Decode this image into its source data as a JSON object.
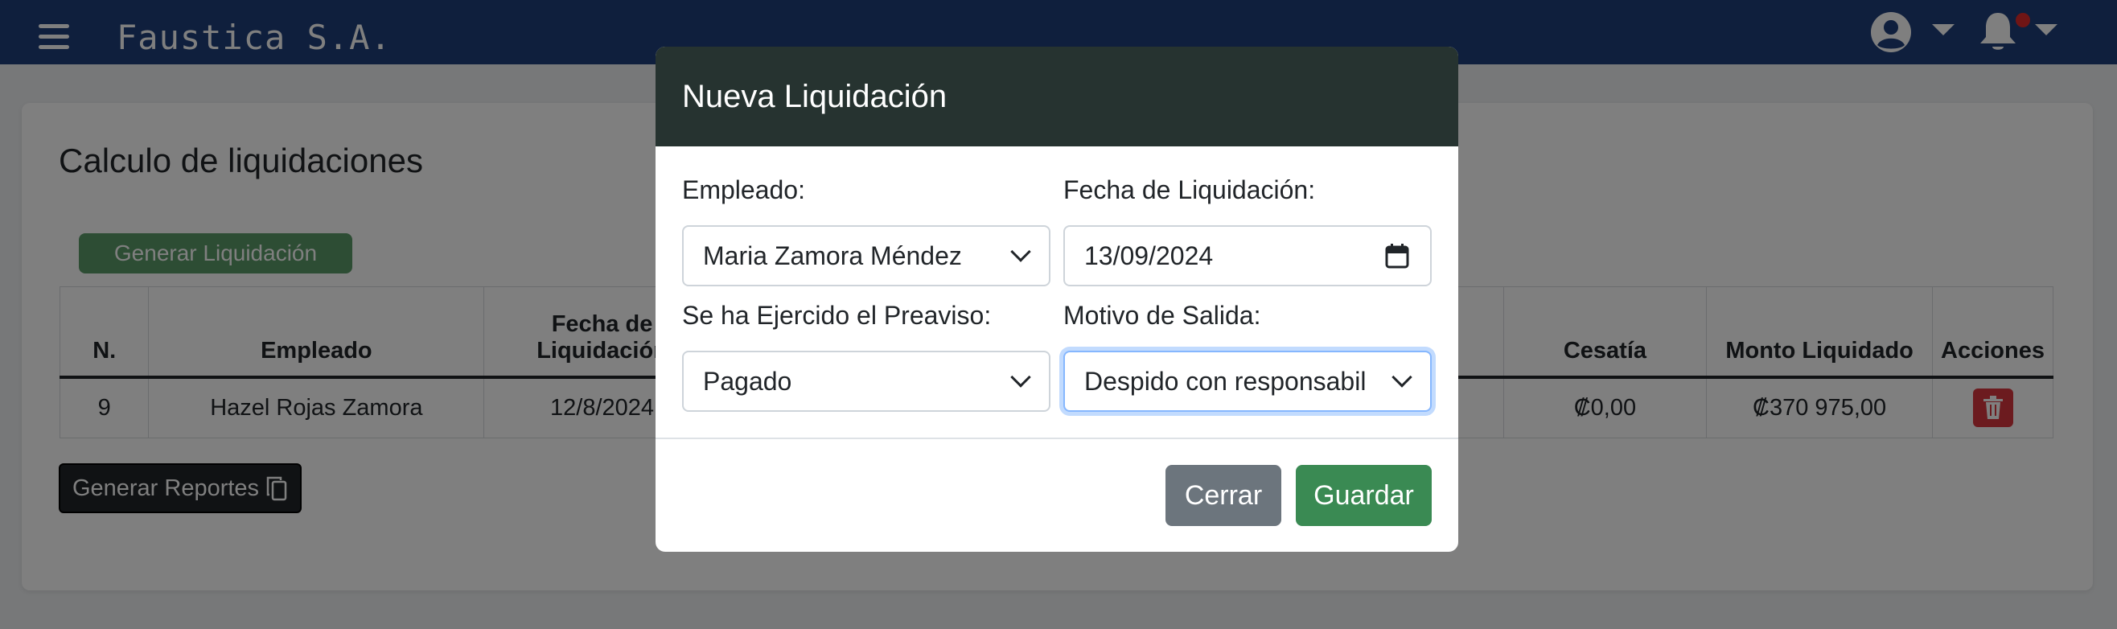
{
  "navbar": {
    "brand": "Faustica S.A.",
    "menu_icon": "hamburger-menu-icon",
    "user_icon": "user-circle-icon",
    "bell_icon": "bell-icon",
    "brand_color": "#1f3f7a"
  },
  "page": {
    "title": "Calculo de liquidaciones",
    "generate_button": "Generar Liquidación",
    "reports_button": "Generar Reportes",
    "reports_icon": "copy-icon"
  },
  "table": {
    "headers": {
      "n": "N.",
      "empleado": "Empleado",
      "fecha": "Fecha de\nLiquidación",
      "cesatia": "Cesatía",
      "monto": "Monto Liquidado",
      "acciones": "Acciones"
    },
    "rows": [
      {
        "n": "9",
        "empleado": "Hazel Rojas Zamora",
        "fecha": "12/8/2024",
        "cesatia": "₡0,00",
        "monto": "₡370 975,00",
        "action_icon": "trash-icon"
      }
    ]
  },
  "modal": {
    "title": "Nueva Liquidación",
    "empleado_label": "Empleado:",
    "empleado_value": "Maria Zamora Méndez",
    "fecha_label": "Fecha de Liquidación:",
    "fecha_value": "13/09/2024",
    "preaviso_label": "Se ha Ejercido el Preaviso:",
    "preaviso_value": "Pagado",
    "motivo_label": "Motivo de Salida:",
    "motivo_value": "Despido con responsabil",
    "close_button": "Cerrar",
    "save_button": "Guardar",
    "header_color": "#263330",
    "save_color": "#3a8a53"
  }
}
